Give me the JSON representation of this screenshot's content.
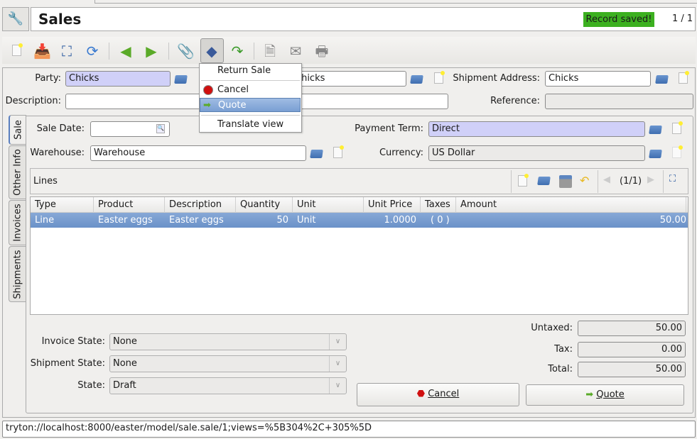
{
  "header": {
    "title": "Sales",
    "status": "Record saved!",
    "record_count": "1 / 1",
    "status_color": "#3cb020"
  },
  "toolbar": {
    "icons": [
      "new-icon",
      "save-icon",
      "switch-view-icon",
      "reload-icon",
      "previous-icon",
      "next-icon",
      "attachment-icon",
      "action-icon",
      "relate-icon",
      "report-icon",
      "email-icon",
      "print-icon"
    ]
  },
  "form": {
    "party_label": "Party:",
    "party": "Chicks",
    "invoice_address": "Chicks",
    "shipment_address_label": "Shipment Address:",
    "shipment_address": "Chicks",
    "description_label": "Description:",
    "description": "",
    "reference_label": "Reference:",
    "reference": "",
    "sale_date_label": "Sale Date:",
    "sale_date": "",
    "payment_term_label": "Payment Term:",
    "payment_term": "Direct",
    "warehouse_label": "Warehouse:",
    "warehouse": "Warehouse",
    "currency_label": "Currency:",
    "currency": "US Dollar"
  },
  "tabs": [
    "Sale",
    "Other Info",
    "Invoices",
    "Shipments"
  ],
  "lines": {
    "title": "Lines",
    "pager": "(1/1)",
    "columns": [
      "Type",
      "Product",
      "Description",
      "Quantity",
      "Unit",
      "Unit Price",
      "Taxes",
      "Amount"
    ],
    "rows": [
      [
        "Line",
        "Easter eggs",
        "Easter eggs",
        "50",
        "Unit",
        "1.0000",
        "( 0 )",
        "50.00"
      ]
    ]
  },
  "states": {
    "invoice_label": "Invoice State:",
    "invoice": "None",
    "shipment_label": "Shipment State:",
    "shipment": "None",
    "state_label": "State:",
    "state": "Draft"
  },
  "totals": {
    "untaxed_label": "Untaxed:",
    "untaxed": "50.00",
    "tax_label": "Tax:",
    "tax": "0.00",
    "total_label": "Total:",
    "total": "50.00"
  },
  "buttons": {
    "cancel": "Cancel",
    "quote": "Quote"
  },
  "menu": {
    "items": [
      "Return Sale",
      "Cancel",
      "Quote",
      "Translate view"
    ]
  },
  "statusbar": {
    "url": "tryton://localhost:8000/easter/model/sale.sale/1;views=%5B304%2C+305%5D"
  }
}
